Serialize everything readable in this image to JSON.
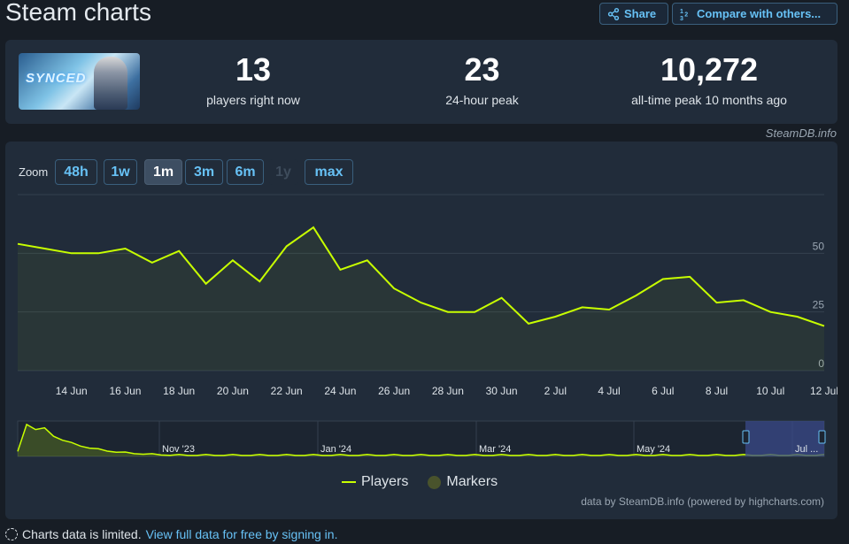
{
  "header": {
    "title": "Steam charts",
    "share_label": "Share",
    "compare_label": "Compare with others..."
  },
  "stats": {
    "now_value": "13",
    "now_label": "players right now",
    "peak24_value": "23",
    "peak24_label": "24-hour peak",
    "alltime_value": "10,272",
    "alltime_label": "all-time peak 10 months ago",
    "game_logo_text": "SYNCED"
  },
  "watermark": "SteamDB.info",
  "zoom": {
    "label": "Zoom",
    "buttons": [
      {
        "label": "48h",
        "state": "normal"
      },
      {
        "label": "1w",
        "state": "normal"
      },
      {
        "label": "1m",
        "state": "active"
      },
      {
        "label": "3m",
        "state": "normal"
      },
      {
        "label": "6m",
        "state": "normal"
      },
      {
        "label": "1y",
        "state": "disabled"
      },
      {
        "label": "max",
        "state": "normal"
      }
    ]
  },
  "chart_data": {
    "type": "line",
    "series": [
      {
        "name": "Players",
        "x": [
          "12 Jun",
          "13 Jun",
          "14 Jun",
          "15 Jun",
          "16 Jun",
          "17 Jun",
          "18 Jun",
          "19 Jun",
          "20 Jun",
          "21 Jun",
          "22 Jun",
          "23 Jun",
          "24 Jun",
          "25 Jun",
          "26 Jun",
          "27 Jun",
          "28 Jun",
          "29 Jun",
          "30 Jun",
          "1 Jul",
          "2 Jul",
          "3 Jul",
          "4 Jul",
          "5 Jul",
          "6 Jul",
          "7 Jul",
          "8 Jul",
          "9 Jul",
          "10 Jul",
          "11 Jul",
          "12 Jul"
        ],
        "values": [
          54,
          52,
          50,
          50,
          52,
          46,
          51,
          37,
          47,
          38,
          53,
          61,
          43,
          47,
          35,
          29,
          25,
          25,
          31,
          20,
          23,
          27,
          26,
          32,
          39,
          40,
          29,
          30,
          25,
          23,
          19
        ]
      }
    ],
    "y_ticks": [
      0,
      25,
      50
    ],
    "ylim": [
      0,
      75
    ],
    "x_tick_labels": [
      "14 Jun",
      "16 Jun",
      "18 Jun",
      "20 Jun",
      "22 Jun",
      "24 Jun",
      "26 Jun",
      "28 Jun",
      "30 Jun",
      "2 Jul",
      "4 Jul",
      "6 Jul",
      "8 Jul",
      "10 Jul",
      "12 Jul"
    ],
    "navigator_labels": [
      "Nov '23",
      "Jan '24",
      "Mar '24",
      "May '24",
      "Jul ..."
    ],
    "legend": [
      "Players",
      "Markers"
    ],
    "grid": true,
    "colors": {
      "line": "#c8ff00",
      "marker": "#49532c",
      "navigator_selection": "#3a4a8a"
    }
  },
  "credits": "data by SteamDB.info (powered by highcharts.com)",
  "footer": {
    "note": "Charts data is limited.",
    "link": "View full data for free by signing in."
  }
}
